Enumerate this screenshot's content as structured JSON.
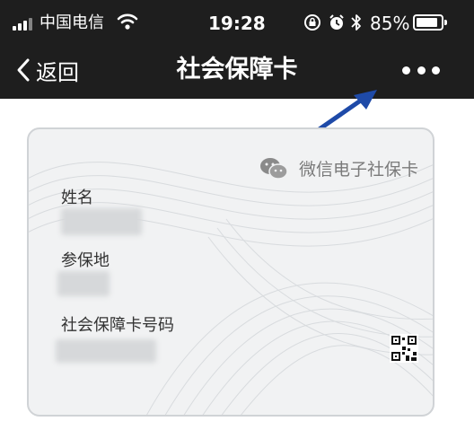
{
  "status_bar": {
    "carrier": "中国电信",
    "time": "19:28",
    "battery_pct": "85%",
    "icons": [
      "signal-icon",
      "wifi-icon",
      "rotation-lock-icon",
      "alarm-icon",
      "bluetooth-icon",
      "battery-icon"
    ]
  },
  "nav": {
    "back_label": "返回",
    "title": "社会保障卡",
    "more_icon": "more-icon"
  },
  "card": {
    "brand": "微信电子社保卡",
    "brand_icon": "wechat-icon",
    "fields": [
      {
        "label": "姓名"
      },
      {
        "label": "参保地"
      },
      {
        "label": "社会保障卡号码"
      }
    ],
    "qr_icon": "qr-code-icon"
  },
  "annotation": {
    "arrow_color": "#1e4aa8"
  },
  "colors": {
    "nav_bg": "#1e1e1e",
    "card_bg": "#f1f2f3",
    "label_text": "#333333"
  }
}
